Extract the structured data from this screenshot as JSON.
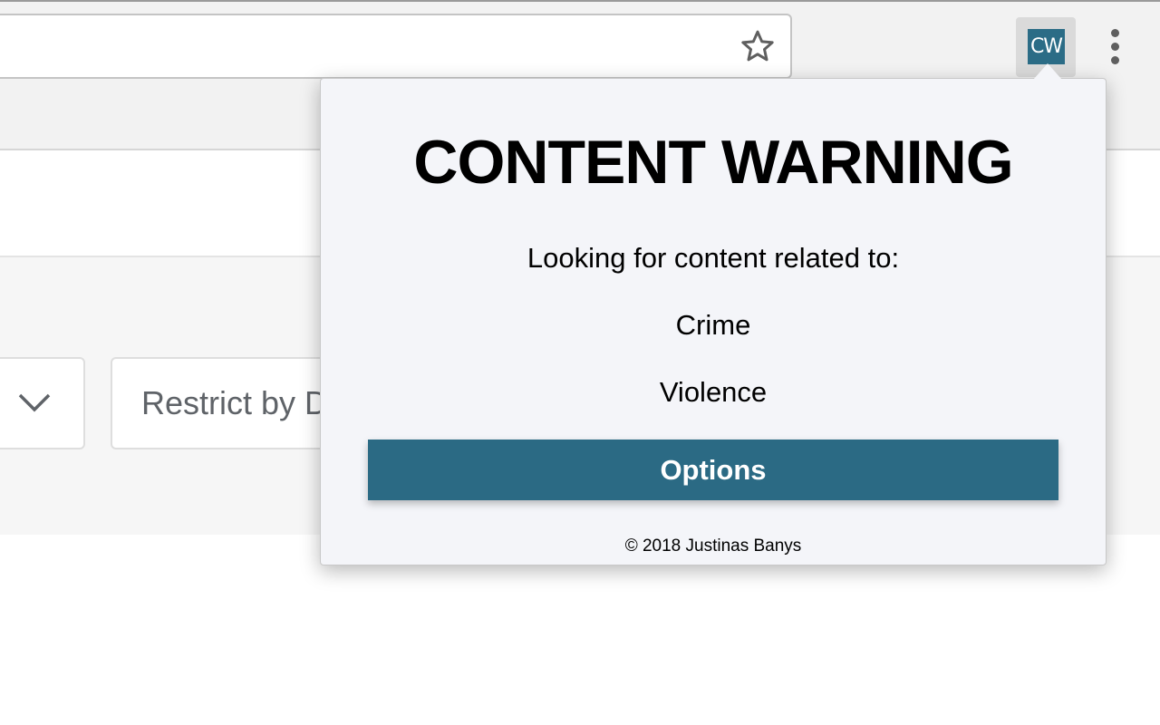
{
  "browser": {
    "extension_badge": "CW"
  },
  "page": {
    "restrict_label": "Restrict by D"
  },
  "popup": {
    "title": "CONTENT WARNING",
    "subtitle": "Looking for content related to:",
    "topics": [
      "Crime",
      "Violence"
    ],
    "options_label": "Options",
    "footer": "© 2018 Justinas Banys"
  },
  "colors": {
    "accent": "#2b6a84",
    "popup_bg": "#f4f5f9",
    "toolbar_bg": "#f2f2f2"
  },
  "icons": [
    "star-icon",
    "menu-icon",
    "chevron-down-icon"
  ]
}
